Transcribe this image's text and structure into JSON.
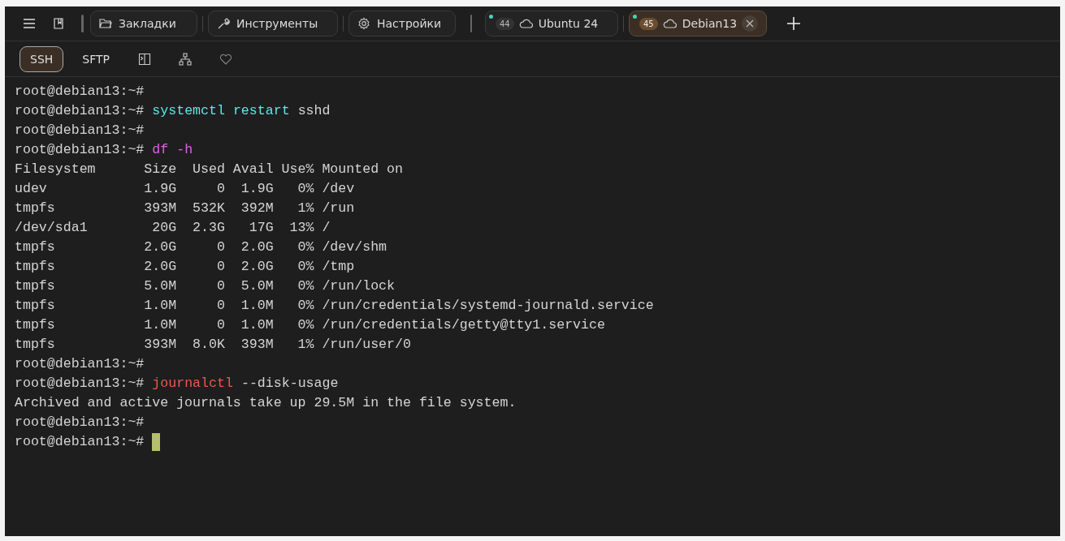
{
  "toolbar_buttons": [
    {
      "label": "Закладки",
      "kind": "folder"
    },
    {
      "label": "Инструменты",
      "kind": "wrench"
    },
    {
      "label": "Настройки",
      "kind": "gear"
    }
  ],
  "session_tabs": [
    {
      "number": "44",
      "label": "Ubuntu 24",
      "selected": false,
      "color": "#4fd1b5"
    },
    {
      "number": "45",
      "label": "Debian13",
      "selected": true,
      "color": "#4fd1b5"
    }
  ],
  "mode_tabs": [
    {
      "label": "SSH",
      "selected": true
    },
    {
      "label": "SFTP",
      "selected": false
    }
  ],
  "terminal_lines": [
    {
      "prompt": "root@debian13:~#"
    },
    {
      "prompt": "root@debian13:~#",
      "command": "systemctl restart",
      "color": "#5ee6ea",
      "args": "sshd"
    },
    {
      "prompt": "root@debian13:~#"
    },
    {
      "prompt": "root@debian13:~#",
      "command": "df -h",
      "color": "#e25fe6"
    },
    {
      "output": "Filesystem      Size  Used Avail Use% Mounted on"
    },
    {
      "output": "udev            1.9G     0  1.9G   0% /dev"
    },
    {
      "output": "tmpfs           393M  532K  392M   1% /run"
    },
    {
      "output": "/dev/sda1        20G  2.3G   17G  13% /"
    },
    {
      "output": "tmpfs           2.0G     0  2.0G   0% /dev/shm"
    },
    {
      "output": "tmpfs           2.0G     0  2.0G   0% /tmp"
    },
    {
      "output": "tmpfs           5.0M     0  5.0M   0% /run/lock"
    },
    {
      "output": "tmpfs           1.0M     0  1.0M   0% /run/credentials/systemd-journald.service"
    },
    {
      "output": "tmpfs           1.0M     0  1.0M   0% /run/credentials/getty@tty1.service"
    },
    {
      "output": "tmpfs           393M  8.0K  393M   1% /run/user/0"
    },
    {
      "prompt": "root@debian13:~#"
    },
    {
      "prompt": "root@debian13:~#",
      "command": "journalctl",
      "color": "#f0574a",
      "args": "--disk-usage"
    },
    {
      "output": "Archived and active journals take up 29.5M in the file system."
    },
    {
      "prompt": "root@debian13:~#"
    },
    {
      "prompt": "root@debian13:~#",
      "cursor": true
    }
  ]
}
